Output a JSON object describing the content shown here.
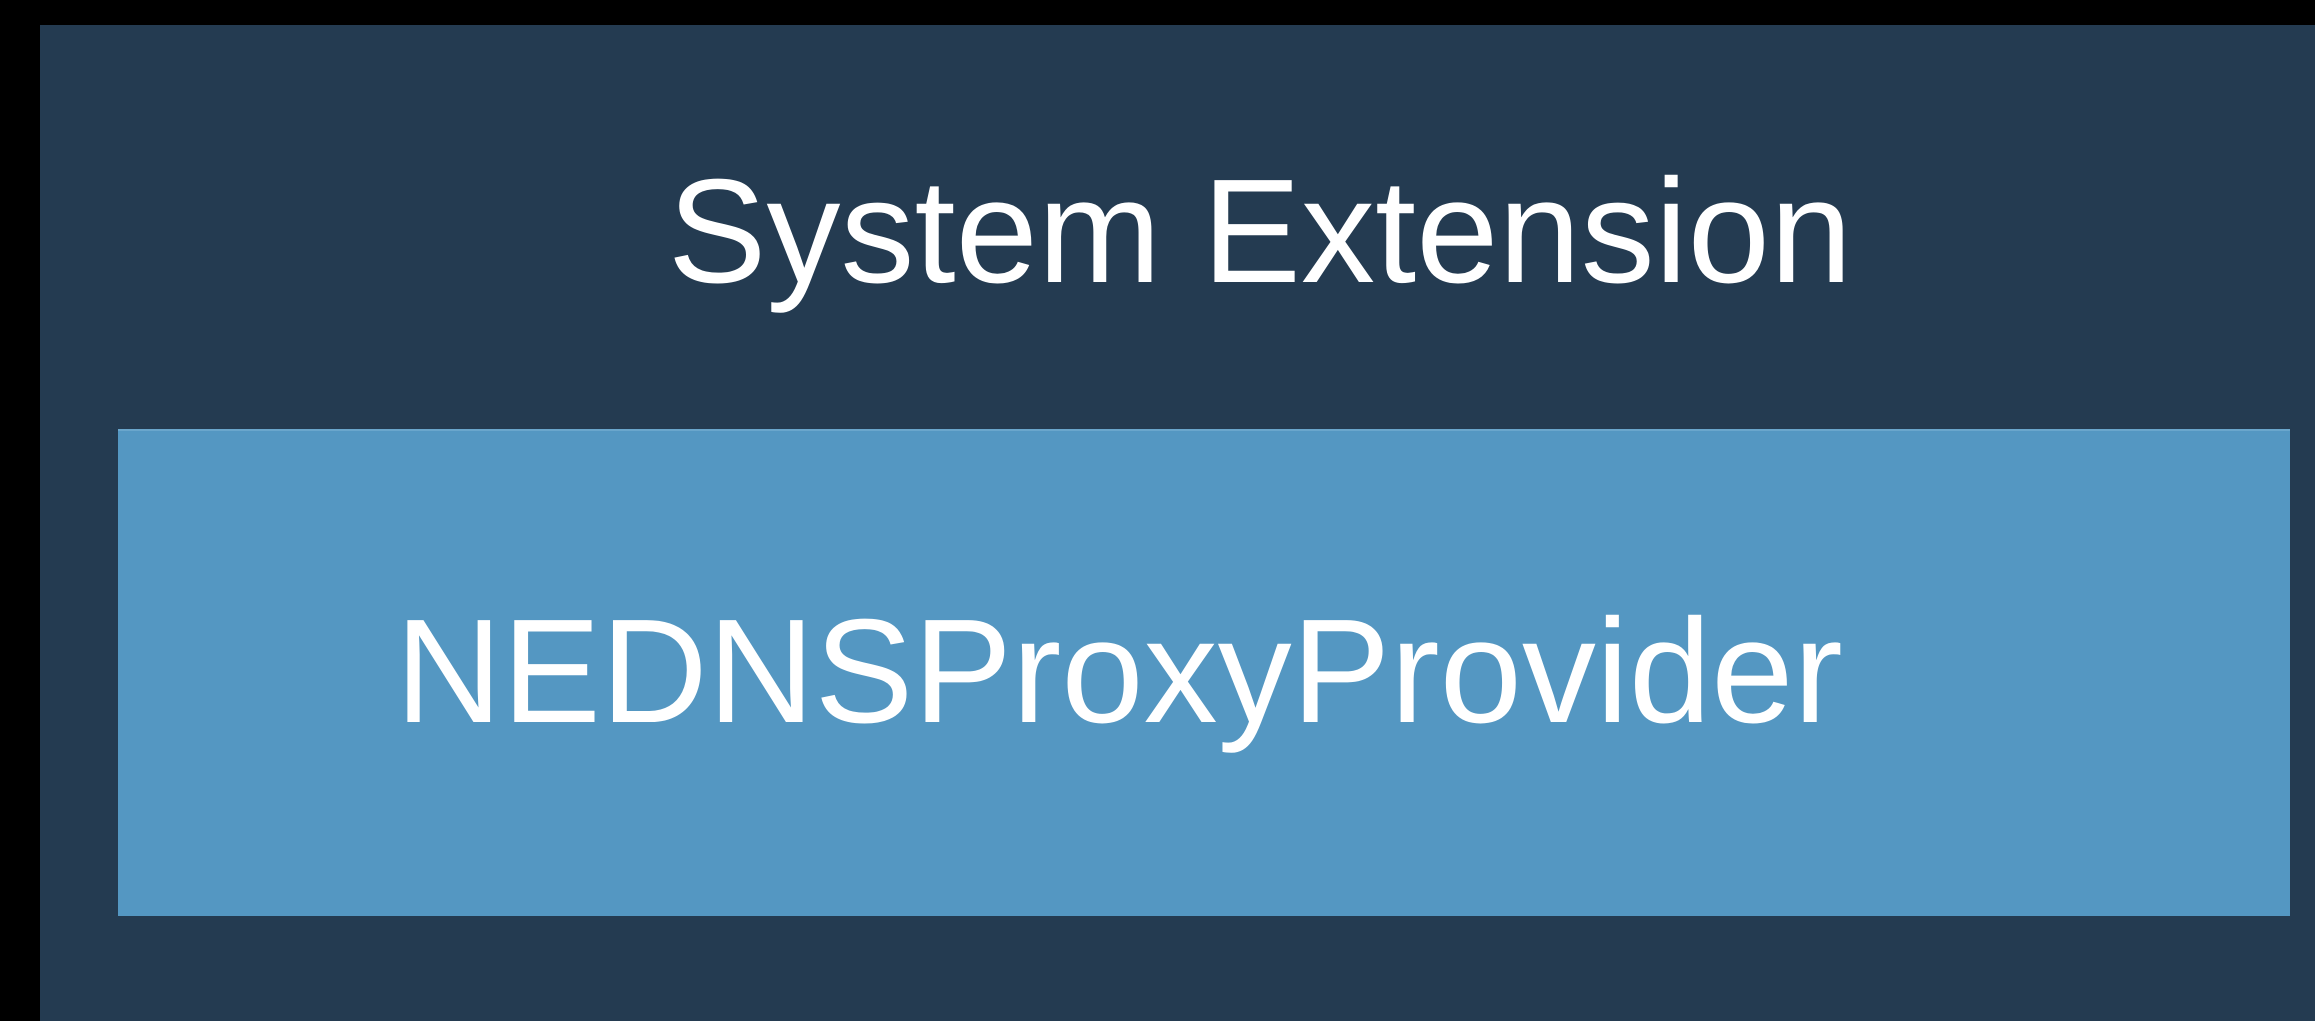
{
  "diagram": {
    "outer": {
      "title": "System Extension"
    },
    "inner": {
      "label": "NEDNSProxyProvider"
    }
  },
  "colors": {
    "background": "#000000",
    "outer_box": "#243b51",
    "inner_box": "#5497c2",
    "text": "#ffffff"
  }
}
